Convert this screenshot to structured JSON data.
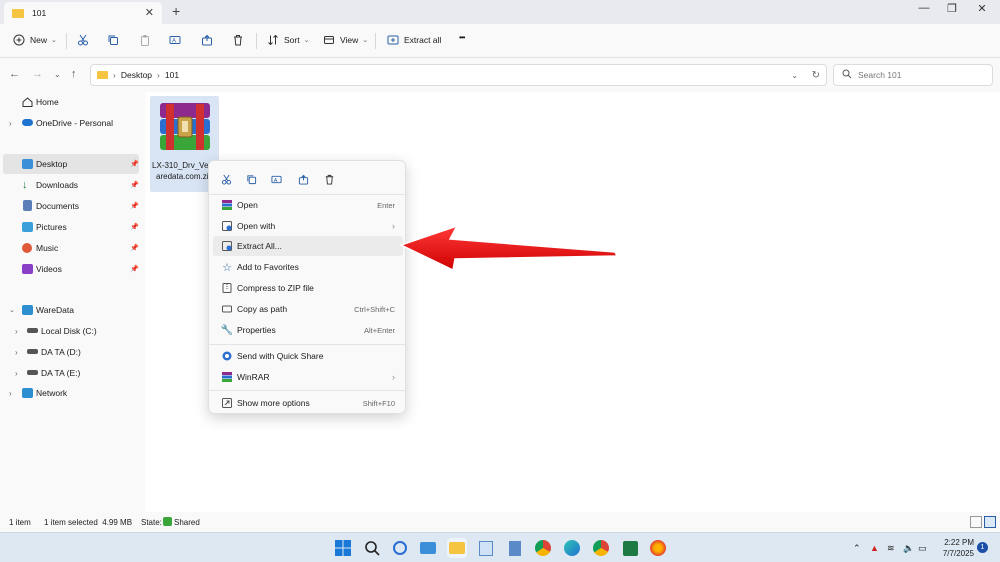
{
  "window": {
    "tab_title": "101",
    "close_tab": "✕",
    "new_tab": "+",
    "minimize": "—",
    "maximize": "❐",
    "close": "✕"
  },
  "toolbar": {
    "new_label": "New",
    "sort_label": "Sort",
    "view_label": "View",
    "extract_all_label": "Extract all",
    "more": "•••"
  },
  "address": {
    "path": [
      "Desktop",
      "101"
    ],
    "separator": "›",
    "search_placeholder": "Search 101"
  },
  "sidebar": {
    "home": "Home",
    "onedrive": "OneDrive - Personal",
    "quick": [
      "Desktop",
      "Downloads",
      "Documents",
      "Pictures",
      "Music",
      "Videos"
    ],
    "waredata": "WareData",
    "drives": [
      "Local Disk (C:)",
      "DA TA (D:)",
      "DA TA (E:)"
    ],
    "network": "Network"
  },
  "file": {
    "name": "LX-310_Drv_Verwaredata.com.zip"
  },
  "context_menu": {
    "items": [
      {
        "label": "Open",
        "shortcut": "Enter"
      },
      {
        "label": "Open with",
        "shortcut": ""
      },
      {
        "label": "Extract All...",
        "shortcut": ""
      },
      {
        "label": "Add to Favorites",
        "shortcut": ""
      },
      {
        "label": "Compress to ZIP file",
        "shortcut": ""
      },
      {
        "label": "Copy as path",
        "shortcut": "Ctrl+Shift+C"
      },
      {
        "label": "Properties",
        "shortcut": "Alt+Enter"
      },
      {
        "label": "Send with Quick Share",
        "shortcut": ""
      },
      {
        "label": "WinRAR",
        "shortcut": ""
      },
      {
        "label": "Show more options",
        "shortcut": "Shift+F10"
      }
    ]
  },
  "status": {
    "count": "1 item",
    "selected": "1 item selected  4.99 MB",
    "state_label": "State:",
    "state_value": "Shared"
  },
  "taskbar": {
    "time": "2:22 PM",
    "date": "7/7/2025",
    "notifications": "1"
  },
  "colors": {
    "arrow": "#e81010",
    "folder": "#f5c542",
    "selection": "#d9e5f5"
  }
}
